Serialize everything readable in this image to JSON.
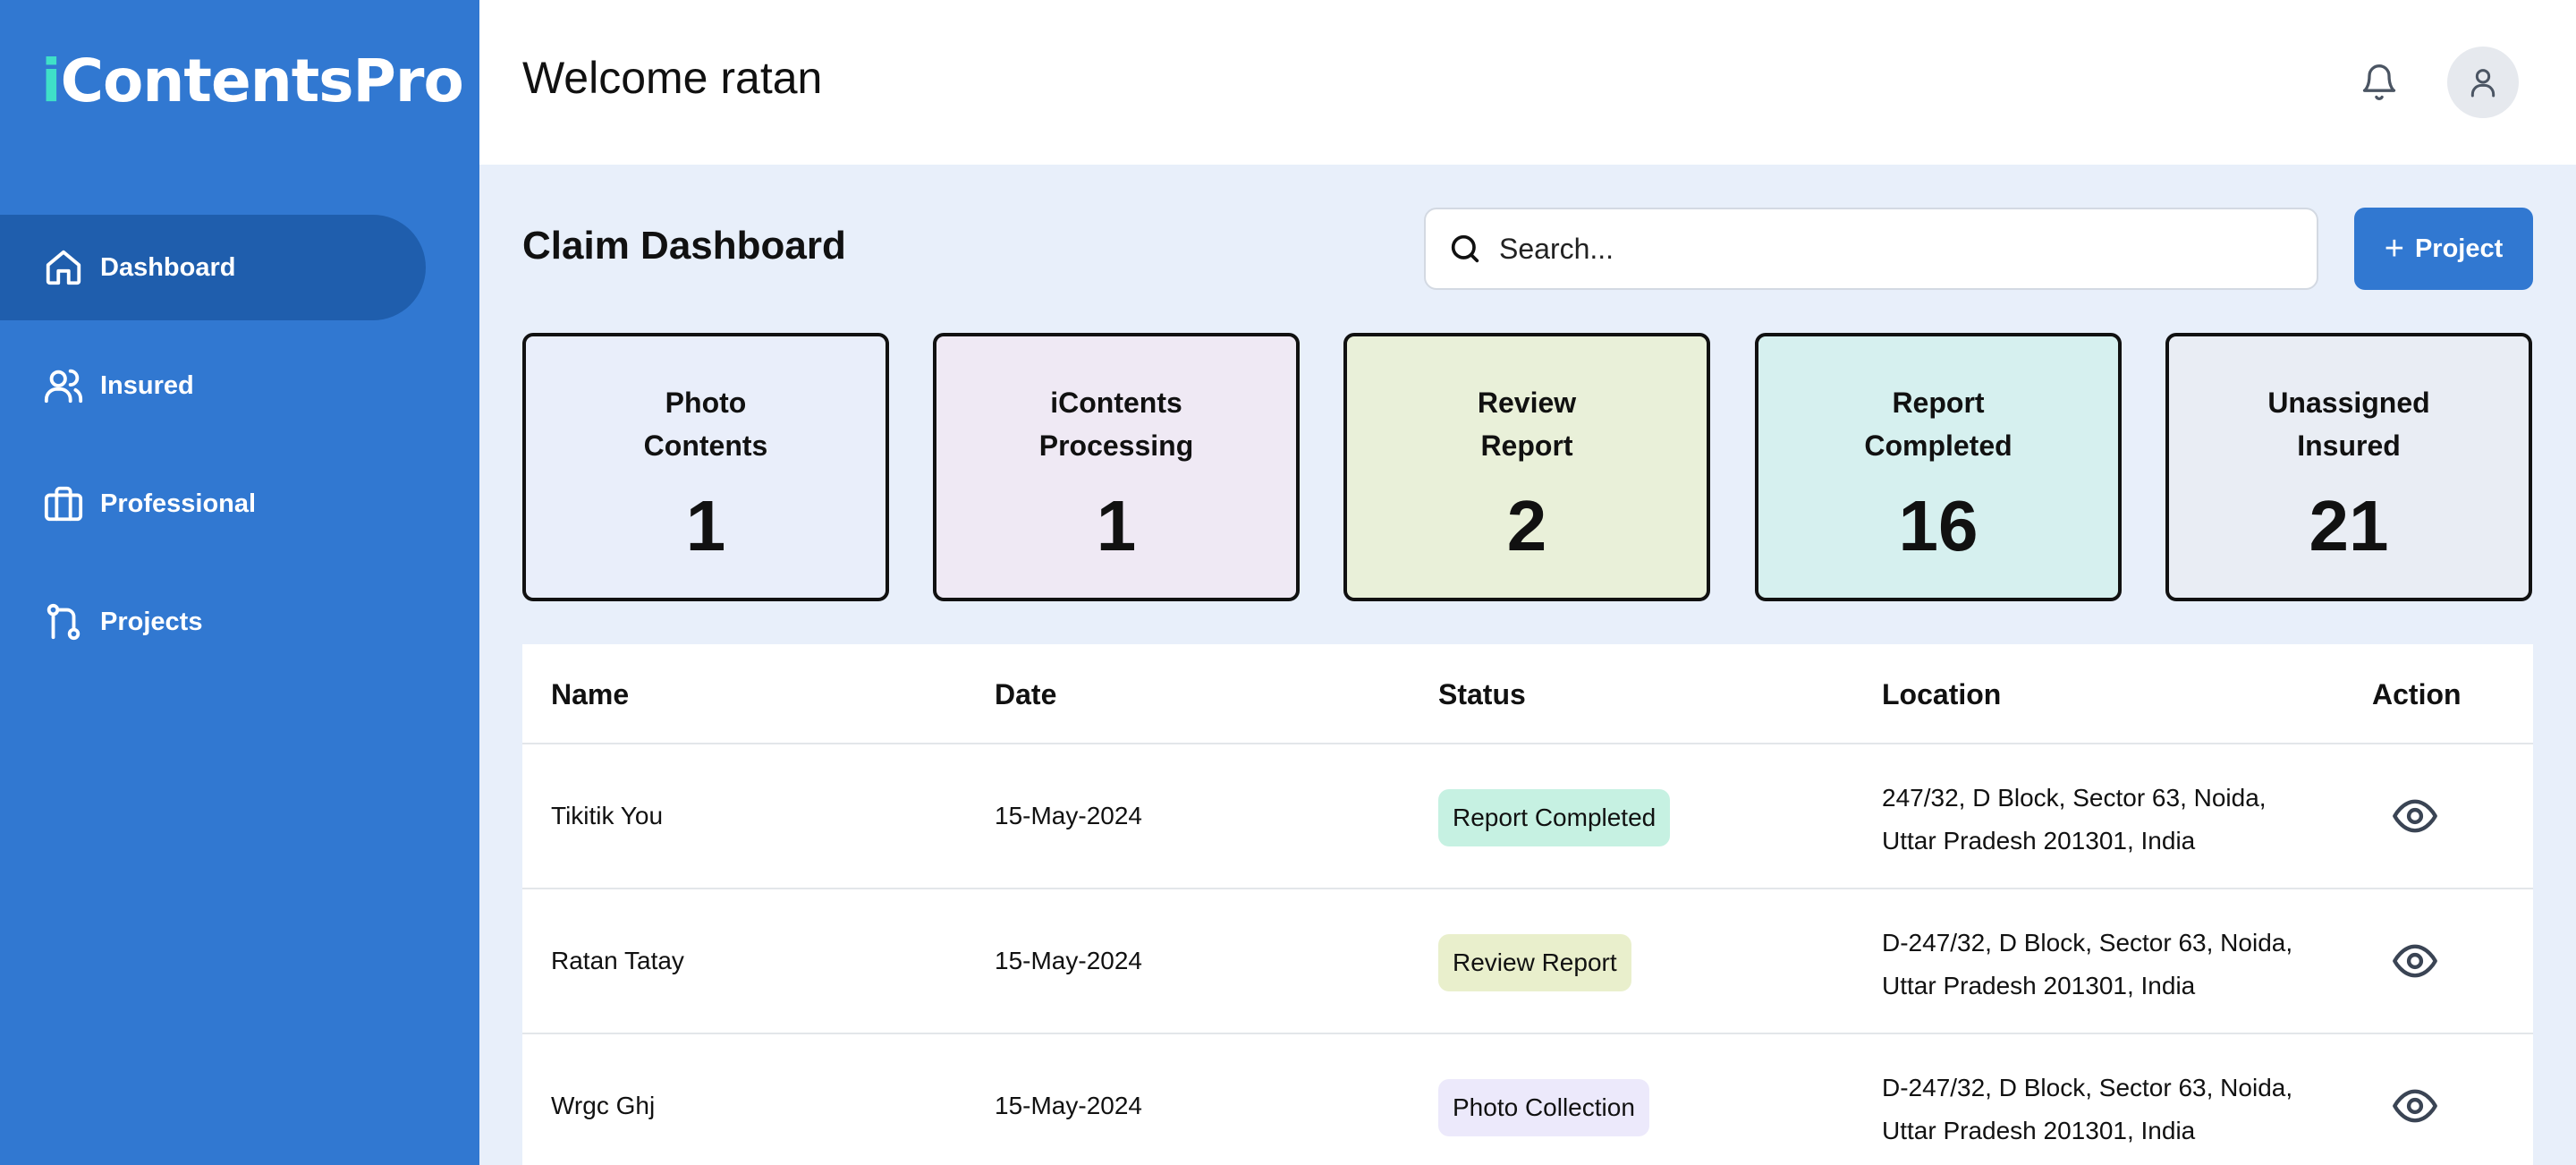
{
  "app": {
    "logo_i": "i",
    "logo_rest": "ContentsPro",
    "accent": "#3178d1",
    "logo_i_color": "#3fe0c8"
  },
  "sidebar": {
    "items": [
      {
        "label": "Dashboard",
        "icon": "home-icon",
        "active": true
      },
      {
        "label": "Insured",
        "icon": "users-icon"
      },
      {
        "label": "Professional",
        "icon": "briefcase-icon"
      },
      {
        "label": "Projects",
        "icon": "git-branch-icon"
      }
    ]
  },
  "header": {
    "welcome": "Welcome ratan",
    "bell_icon": "bell-icon",
    "avatar_icon": "user-icon"
  },
  "main": {
    "title": "Claim Dashboard",
    "search_placeholder": "Search...",
    "add_button_plus": "+",
    "add_button_label": "Project"
  },
  "stats": [
    {
      "line1": "Photo",
      "line2": "Contents",
      "value": "1",
      "color": "#e9eefa"
    },
    {
      "line1": "iContents",
      "line2": "Processing",
      "value": "1",
      "color": "#efe9f4"
    },
    {
      "line1": "Review",
      "line2": "Report",
      "value": "2",
      "color": "#e9f0d9"
    },
    {
      "line1": "Report",
      "line2": "Completed",
      "value": "16",
      "color": "#d6f0ef"
    },
    {
      "line1": "Unassigned",
      "line2": "Insured",
      "value": "21",
      "color": "#e9edf4"
    }
  ],
  "table": {
    "headers": [
      "Name",
      "Date",
      "Status",
      "Location",
      "Action"
    ],
    "rows": [
      {
        "name": "Tikitik You",
        "date": "15-May-2024",
        "status": "Report Completed",
        "status_color": "#c6f1e2",
        "loc1": "247/32, D Block, Sector 63, Noida,",
        "loc2": "Uttar Pradesh 201301, India",
        "action_icon": "eye-icon"
      },
      {
        "name": "Ratan Tatay",
        "date": "15-May-2024",
        "status": "Review Report",
        "status_color": "#e9efcc",
        "loc1": "D-247/32, D Block, Sector 63, Noida,",
        "loc2": "Uttar Pradesh 201301, India",
        "action_icon": "eye-icon"
      },
      {
        "name": "Wrgc Ghj",
        "date": "15-May-2024",
        "status": "Photo Collection",
        "status_color": "#ece9fb",
        "loc1": "D-247/32, D Block, Sector 63, Noida,",
        "loc2": "Uttar Pradesh 201301, India",
        "action_icon": "eye-icon"
      }
    ]
  }
}
